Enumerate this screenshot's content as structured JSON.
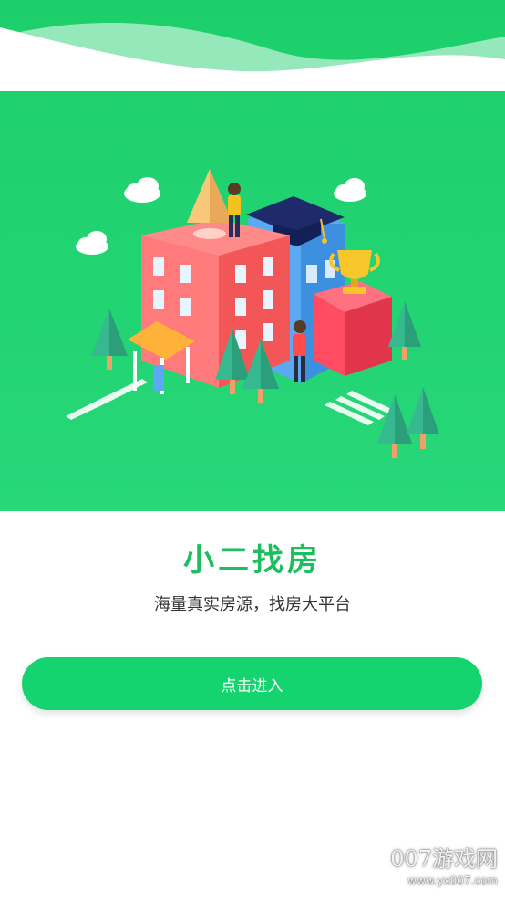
{
  "app": {
    "title": "小二找房",
    "subtitle": "海量真实房源，找房大平台"
  },
  "actions": {
    "enter_label": "点击进入"
  },
  "watermark": {
    "brand": "007游戏网",
    "url": "www.yx007.com"
  },
  "colors": {
    "hero_bg": "#1dcf6a",
    "accent": "#15d36e",
    "title": "#1ebd5f",
    "text": "#333333"
  },
  "icons": [
    "cloud-icon",
    "graduation-cap-icon",
    "trophy-icon",
    "tree-icon",
    "building-icon"
  ]
}
